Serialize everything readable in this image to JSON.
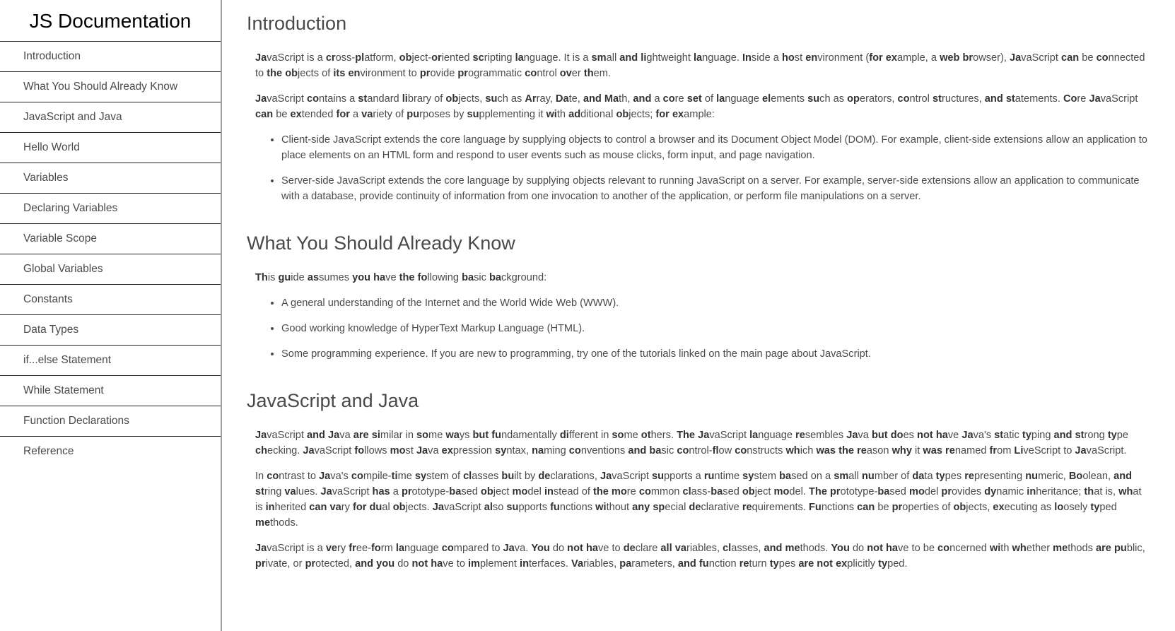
{
  "nav": {
    "title": "JS Documentation",
    "items": [
      "Introduction",
      "What You Should Already Know",
      "JavaScript and Java",
      "Hello World",
      "Variables",
      "Declaring Variables",
      "Variable Scope",
      "Global Variables",
      "Constants",
      "Data Types",
      "if...else Statement",
      "While Statement",
      "Function Declarations",
      "Reference"
    ]
  },
  "sections": [
    {
      "title": "Introduction",
      "paragraphs": [
        "JavaScript is a cross-platform, object-oriented scripting language. It is a small and lightweight language. Inside a host environment (for example, a web browser), JavaScript can be connected to the objects of its environment to provide programmatic control over them.",
        "JavaScript contains a standard library of objects, such as Array, Date, and Math, and a core set of language elements such as operators, control structures, and statements. Core JavaScript can be extended for a variety of purposes by supplementing it with additional objects; for example:"
      ],
      "bullets": [
        "Client-side JavaScript extends the core language by supplying objects to control a browser and its Document Object Model (DOM). For example, client-side extensions allow an application to place elements on an HTML form and respond to user events such as mouse clicks, form input, and page navigation.",
        "Server-side JavaScript extends the core language by supplying objects relevant to running JavaScript on a server. For example, server-side extensions allow an application to communicate with a database, provide continuity of information from one invocation to another of the application, or perform file manipulations on a server."
      ]
    },
    {
      "title": "What You Should Already Know",
      "paragraphs": [
        "This guide assumes you have the following basic background:"
      ],
      "bullets": [
        "A general understanding of the Internet and the World Wide Web (WWW).",
        "Good working knowledge of HyperText Markup Language (HTML).",
        "Some programming experience. If you are new to programming, try one of the tutorials linked on the main page about JavaScript."
      ]
    },
    {
      "title": "JavaScript and Java",
      "paragraphs": [
        "JavaScript and Java are similar in some ways but fundamentally different in some others. The JavaScript language resembles Java but does not have Java's static typing and strong type checking. JavaScript follows most Java expression syntax, naming conventions and basic control-flow constructs which was the reason why it was renamed from LiveScript to JavaScript.",
        "In contrast to Java's compile-time system of classes built by declarations, JavaScript supports a runtime system based on a small number of data types representing numeric, Boolean, and string values. JavaScript has a prototype-based object model instead of the more common class-based object model. The prototype-based model provides dynamic inheritance; that is, what is inherited can vary for dual objects. JavaScript also supports functions without any special declarative requirements. Functions can be properties of objects, executing as loosely typed methods.",
        "JavaScript is a very free-form language compared to Java. You do not have to declare all variables, classes, and methods. You do not have to be concerned with whether methods are public, private, or protected, and you do not have to implement interfaces. Variables, parameters, and function return types are not explicitly typed."
      ],
      "bullets": []
    }
  ]
}
